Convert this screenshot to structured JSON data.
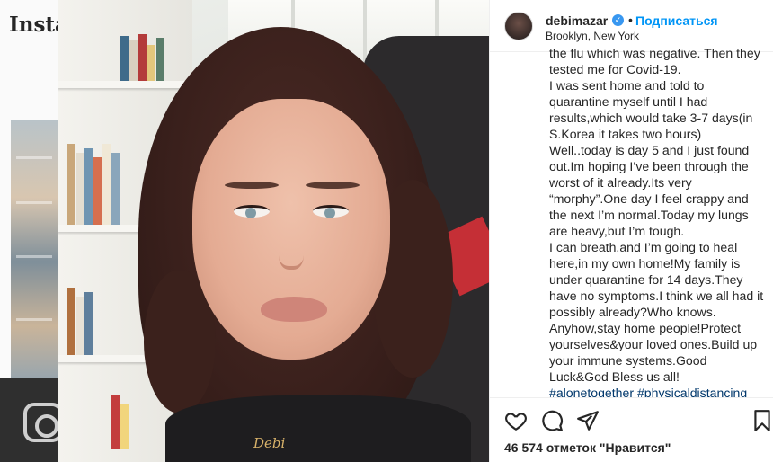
{
  "background": {
    "logo_text": "Insta"
  },
  "post": {
    "username": "debimazar",
    "verified_mark": "✓",
    "separator": "•",
    "follow_label": "Подписаться",
    "location": "Brooklyn, New York",
    "necklace_text": "Debi",
    "caption_lines": [
      "the flu which was negative. Then they",
      "tested me for Covid-19.",
      "I was sent home and told to",
      "quarantine myself until I had",
      "results,which would take 3-7 days(in",
      "S.Korea it takes two hours)",
      "Well..today is day 5 and I just found",
      "out.Im hoping I’ve been through the",
      "worst of it already.Its very",
      "“morphy”.One day I feel crappy and",
      "the next I’m normal.Today my lungs",
      "are heavy,but I’m tough.",
      "I can breath,and I’m going to heal",
      "here,in my own home!My family is",
      "under quarantine for 14 days.They",
      "have no symptoms.I think we all had it",
      "possibly already?Who knows.",
      "Anyhow,stay home people!Protect",
      "yourselves&your loved ones.Build up",
      "your immune systems.Good",
      "Luck&God Bless us all!"
    ],
    "hashtags_line": "#alonetogether #physicaldistancing",
    "likes_text": "46 574 отметок \"Нравится\"",
    "icons": [
      "heart-icon",
      "comment-icon",
      "share-icon",
      "bookmark-icon"
    ]
  },
  "colors": {
    "follow_blue": "#0095f6",
    "verified_blue": "#3897f0",
    "text": "#262626"
  }
}
